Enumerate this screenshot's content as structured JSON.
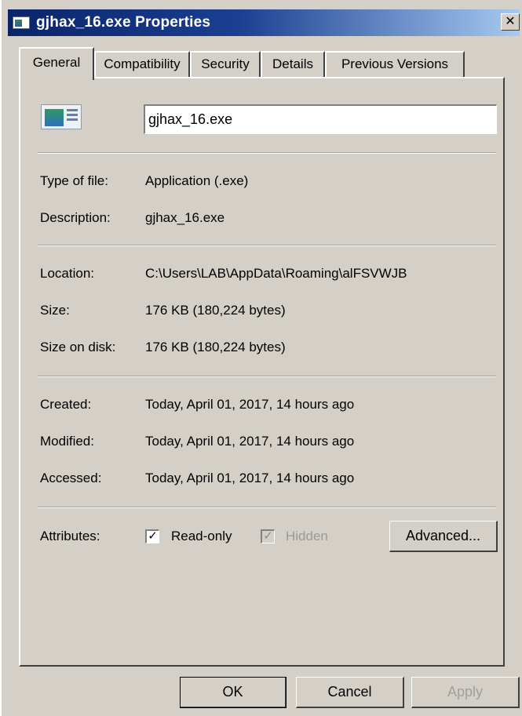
{
  "window": {
    "title": "gjhax_16.exe Properties",
    "close_glyph": "✕"
  },
  "tabs": [
    {
      "label": "General",
      "active": true
    },
    {
      "label": "Compatibility",
      "active": false
    },
    {
      "label": "Security",
      "active": false
    },
    {
      "label": "Details",
      "active": false
    },
    {
      "label": "Previous Versions",
      "active": false
    }
  ],
  "general": {
    "file_icon": "application-icon",
    "file_name": "gjhax_16.exe",
    "type_label": "Type of file:",
    "type_value": "Application (.exe)",
    "description_label": "Description:",
    "description_value": "gjhax_16.exe",
    "location_label": "Location:",
    "location_value": "C:\\Users\\LAB\\AppData\\Roaming\\alFSVWJB",
    "size_label": "Size:",
    "size_value": "176 KB (180,224 bytes)",
    "size_on_disk_label": "Size on disk:",
    "size_on_disk_value": "176 KB (180,224 bytes)",
    "created_label": "Created:",
    "created_value": "Today, April 01, 2017, 14 hours ago",
    "modified_label": "Modified:",
    "modified_value": "Today, April 01, 2017, 14 hours ago",
    "accessed_label": "Accessed:",
    "accessed_value": "Today, April 01, 2017, 14 hours ago",
    "attributes_label": "Attributes:",
    "readonly_label": "Read-only",
    "readonly_checked": true,
    "hidden_label": "Hidden",
    "hidden_checked": true,
    "check_glyph": "✓",
    "advanced_label": "Advanced..."
  },
  "footer": {
    "ok_label": "OK",
    "cancel_label": "Cancel",
    "apply_label": "Apply"
  }
}
